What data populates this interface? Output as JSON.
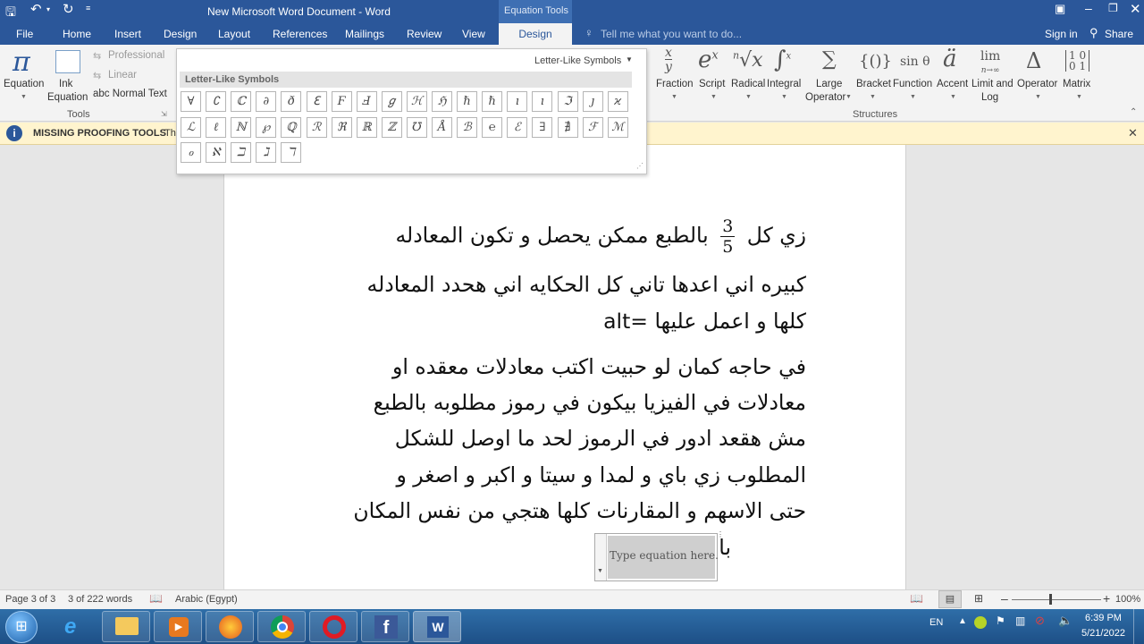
{
  "window": {
    "title": "New Microsoft Word Document - Word",
    "context_group": "Equation Tools"
  },
  "tabs": [
    "File",
    "Home",
    "Insert",
    "Design",
    "Layout",
    "References",
    "Mailings",
    "Review",
    "View",
    "Design"
  ],
  "tell_me": "Tell me what you want to do...",
  "account": {
    "signin": "Sign in",
    "share": "Share"
  },
  "tools": {
    "equation": "Equation",
    "ink_l1": "Ink",
    "ink_l2": "Equation",
    "professional": "Professional",
    "linear": "Linear",
    "normal_text": "abc Normal Text",
    "group": "Tools"
  },
  "structures": {
    "group": "Structures",
    "items": [
      {
        "label": "Fraction",
        "glyph": "x/y"
      },
      {
        "label": "Script",
        "glyph": "eˣ"
      },
      {
        "label": "Radical",
        "glyph": "ⁿ√x"
      },
      {
        "label": "Integral",
        "glyph": "∫"
      },
      {
        "label": "Large",
        "label2": "Operator",
        "glyph": "∑"
      },
      {
        "label": "Bracket",
        "glyph": "{()}"
      },
      {
        "label": "Function",
        "glyph": "sin θ"
      },
      {
        "label": "Accent",
        "glyph": "ä"
      },
      {
        "label": "Limit and",
        "label2": "Log",
        "glyph": "lim"
      },
      {
        "label": "Operator",
        "glyph": "Δ"
      },
      {
        "label": "Matrix",
        "glyph": "[1 0; 0 1]"
      }
    ]
  },
  "gallery": {
    "dropdown": "Letter-Like Symbols",
    "header": "Letter-Like Symbols",
    "row1": [
      "∀",
      "∁",
      "ℂ",
      "∂",
      "ð",
      "ℇ",
      "Ϝ",
      "Ⅎ",
      "ℊ",
      "ℋ",
      "ℌ",
      "ℏ",
      "ℏ",
      "ı",
      "ı",
      "ℑ",
      "ȷ",
      "ϰ"
    ],
    "row2": [
      "ℒ",
      "ℓ",
      "ℕ",
      "℘",
      "ℚ",
      "ℛ",
      "ℜ",
      "ℝ",
      "ℤ",
      "℧",
      "Å",
      "ℬ",
      "℮",
      "ℰ",
      "∃",
      "∄",
      "ℱ",
      "ℳ"
    ],
    "row3": [
      "ℴ",
      "ℵ",
      "ℶ",
      "ℷ",
      "ℸ"
    ]
  },
  "message": {
    "title": "MISSING PROOFING TOOLS",
    "text": "Th"
  },
  "document": {
    "line1a": "زي كل",
    "frac_num": "3",
    "frac_den": "5",
    "line1b": "بالطبع ممكن يحصل و تكون المعادله",
    "lines": [
      "كبيره اني اعدها تاني كل الحكايه اني هحدد المعادله",
      "كلها و اعمل عليها =alt",
      "في حاجه كمان لو حبيت اكتب معادلات معقده او",
      "معادلات في الفيزيا بيكون في رموز مطلوبه بالطبع",
      "مش هقعد ادور في الرموز لحد ما اوصل للشكل",
      "المطلوب زي باي و لمدا و سيتا و اكبر و اصغر و",
      "حتى الاسهم و المقارنات كلها هتجي من نفس المكان",
      "بالشكل دا"
    ],
    "placeholder": "Type equation here."
  },
  "status": {
    "page": "Page 3 of 3",
    "words": "3 of 222 words",
    "lang": "Arabic (Egypt)",
    "zoom": "100%"
  },
  "taskbar": {
    "lang": "EN",
    "time": "6:39 PM",
    "date": "5/21/2022"
  },
  "colors": {
    "word_blue": "#2b579a",
    "ribbon": "#f3f3f3",
    "message": "#fff4ce"
  }
}
